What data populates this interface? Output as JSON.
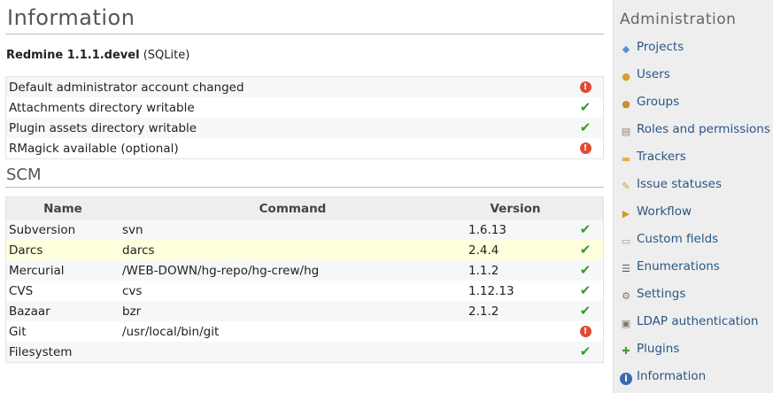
{
  "page": {
    "title": "Information"
  },
  "version": {
    "product": "Redmine 1.1.1.devel",
    "db": "(SQLite)"
  },
  "checks": [
    {
      "label": "Default administrator account changed",
      "ok": false
    },
    {
      "label": "Attachments directory writable",
      "ok": true
    },
    {
      "label": "Plugin assets directory writable",
      "ok": true
    },
    {
      "label": "RMagick available (optional)",
      "ok": false
    }
  ],
  "scm": {
    "title": "SCM",
    "headers": {
      "name": "Name",
      "command": "Command",
      "version": "Version"
    },
    "rows": [
      {
        "name": "Subversion",
        "command": "svn",
        "version": "1.6.13",
        "ok": true
      },
      {
        "name": "Darcs",
        "command": "darcs",
        "version": "2.4.4",
        "ok": true
      },
      {
        "name": "Mercurial",
        "command": "/WEB-DOWN/hg-repo/hg-crew/hg",
        "version": "1.1.2",
        "ok": true
      },
      {
        "name": "CVS",
        "command": "cvs",
        "version": "1.12.13",
        "ok": true
      },
      {
        "name": "Bazaar",
        "command": "bzr",
        "version": "2.1.2",
        "ok": true
      },
      {
        "name": "Git",
        "command": "/usr/local/bin/git",
        "version": "",
        "ok": false
      },
      {
        "name": "Filesystem",
        "command": "",
        "version": "",
        "ok": true
      }
    ]
  },
  "icons": {
    "ok": "check-icon",
    "error": "exclamation-icon"
  },
  "colors": {
    "ok": "#3a9a2a",
    "error": "#e04a32",
    "link": "#2a5685",
    "highlight_row": "#ffffdd"
  },
  "sidebar": {
    "title": "Administration",
    "items": [
      {
        "label": "Projects",
        "icon": "projects-icon"
      },
      {
        "label": "Users",
        "icon": "user-icon"
      },
      {
        "label": "Groups",
        "icon": "group-icon"
      },
      {
        "label": "Roles and permissions",
        "icon": "roles-icon"
      },
      {
        "label": "Trackers",
        "icon": "tracker-icon"
      },
      {
        "label": "Issue statuses",
        "icon": "issue-status-icon"
      },
      {
        "label": "Workflow",
        "icon": "workflow-icon"
      },
      {
        "label": "Custom fields",
        "icon": "custom-fields-icon"
      },
      {
        "label": "Enumerations",
        "icon": "list-icon"
      },
      {
        "label": "Settings",
        "icon": "gear-icon"
      },
      {
        "label": "LDAP authentication",
        "icon": "server-auth-icon"
      },
      {
        "label": "Plugins",
        "icon": "plugin-icon"
      },
      {
        "label": "Information",
        "icon": "info-icon"
      }
    ]
  }
}
